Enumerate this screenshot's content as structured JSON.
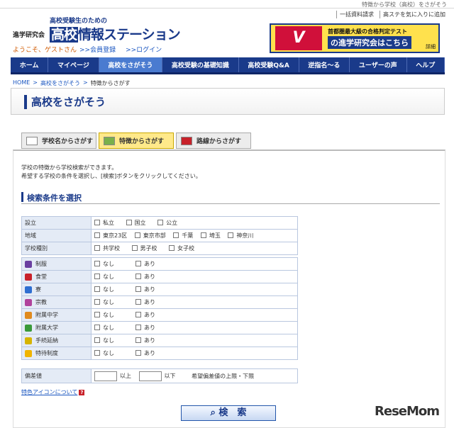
{
  "header": {
    "top_caption": "特徴から学校（高校）をさがそう",
    "top_links": [
      "一括資料請求",
      "高ステを気に入りに追加"
    ],
    "logo_left": "進学研究会",
    "logo_sub": "高校受験生のための",
    "logo_main_highlight": "高校",
    "logo_main_rest": "情報ステーション",
    "welcome": "ようこそ、ゲストさん",
    "register_link": ">>会員登録",
    "login_link": ">>ログイン"
  },
  "banner": {
    "big_letter": "V",
    "top_text": "首都圏最大級の合格判定テスト",
    "main_text": "の進学研究会はこちら",
    "more_text": "詳細"
  },
  "nav": {
    "items": [
      "ホーム",
      "マイページ",
      "高校をさがそう",
      "高校受験の基礎知識",
      "高校受験Q&A",
      "逆指名〜る",
      "ユーザーの声",
      "ヘルプ"
    ],
    "active_index": 2
  },
  "breadcrumb": {
    "home": "HOME",
    "sep": ">",
    "level1": "高校をさがそう",
    "current": "特徴からさがす"
  },
  "page_title": "高校をさがそう",
  "tabs": [
    {
      "label": "学校名からさがす",
      "icon": "building-icon"
    },
    {
      "label": "特徴からさがす",
      "icon": "school-icon"
    },
    {
      "label": "路線からさがす",
      "icon": "train-icon"
    }
  ],
  "description": {
    "line1": "学校の特徴から学校検索ができます。",
    "line2": "希望する学校の条件を選択し、[検索]ボタンをクリックしてください。"
  },
  "section_title": "検索条件を選択",
  "basic_conditions": [
    {
      "label": "設立",
      "options": [
        "私立",
        "国立",
        "公立"
      ]
    },
    {
      "label": "地域",
      "options": [
        "東京23区",
        "東京市部",
        "千葉",
        "埼玉",
        "神奈川"
      ]
    },
    {
      "label": "学校種別",
      "options": [
        "共学校",
        "男子校",
        "女子校"
      ]
    }
  ],
  "feature_conditions": [
    {
      "label": "制服",
      "icon": "uniform-icon",
      "color": "#6a3fa0"
    },
    {
      "label": "食堂",
      "icon": "cafeteria-icon",
      "color": "#c8212a"
    },
    {
      "label": "寮",
      "icon": "dorm-icon",
      "color": "#2f6fd1"
    },
    {
      "label": "宗教",
      "icon": "religion-icon",
      "color": "#b0439c"
    },
    {
      "label": "附属中学",
      "icon": "junior-high-icon",
      "color": "#e08a1e"
    },
    {
      "label": "附属大学",
      "icon": "university-icon",
      "color": "#3a9a3a"
    },
    {
      "label": "手続延納",
      "icon": "yen-icon",
      "color": "#d6b400"
    },
    {
      "label": "特待制度",
      "icon": "star-icon",
      "color": "#f0b400"
    }
  ],
  "feature_options": [
    "なし",
    "あり"
  ],
  "deviation": {
    "label": "偏差値",
    "lower_suffix": "以上",
    "upper_suffix": "以下",
    "hint": "希望偏差値の上限・下限",
    "lower_value": "",
    "upper_value": ""
  },
  "icon_note": "特色アイコンについて",
  "icon_note_mark": "?",
  "search_button": "検　索",
  "watermark": "ReseMom"
}
